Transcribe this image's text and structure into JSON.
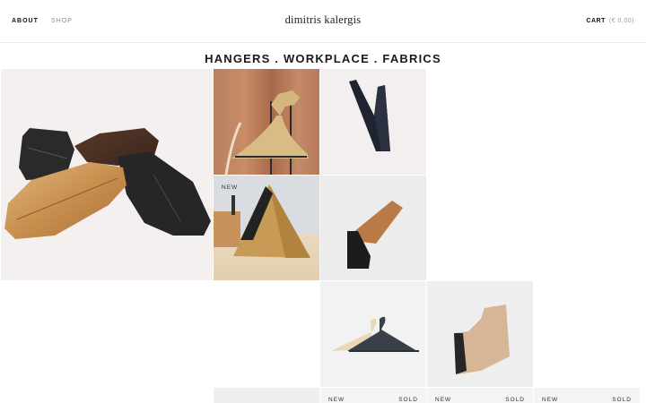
{
  "nav": {
    "about": "ABOUT",
    "shop": "SHOP"
  },
  "brand": {
    "logo": "dimitris kalergis"
  },
  "cart": {
    "label": "CART",
    "total": "(€ 0,00)"
  },
  "page": {
    "heading": "HANGERS . WORKPLACE . FABRICS"
  },
  "products": [
    {
      "image": "wooden-tile-pieces-image"
    },
    {
      "image": "gold-bird-hanger-image"
    },
    {
      "image": "black-wall-hook-image"
    },
    {
      "image": "triangle-phone-stand-image",
      "badge_new": "NEW"
    },
    {
      "image": "wooden-wall-hook-image"
    },
    {
      "image": "two-hangers-image"
    },
    {
      "image": "wood-stand-image"
    },
    {
      "image": "bottom-product-1-image"
    },
    {
      "image": "bottom-product-2-image",
      "badge_new": "NEW",
      "badge_sold": "SOLD"
    },
    {
      "image": "bottom-product-3-image",
      "badge_new": "NEW",
      "badge_sold": "SOLD"
    },
    {
      "image": "bottom-product-4-image",
      "badge_new": "NEW",
      "badge_sold": "SOLD"
    }
  ],
  "colors": {
    "background": "#ffffff",
    "text": "#222222",
    "muted": "#888888"
  }
}
